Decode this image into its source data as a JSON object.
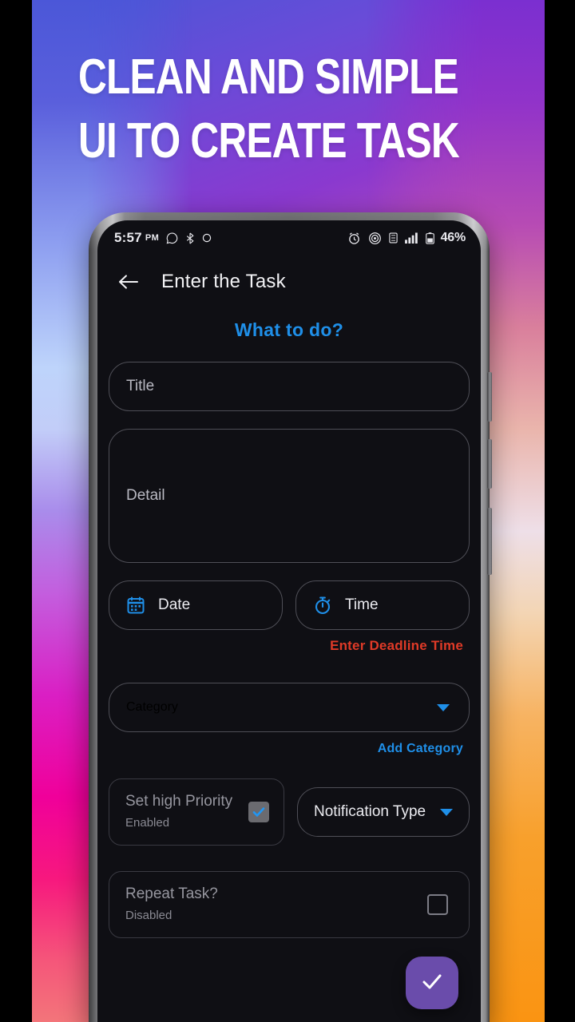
{
  "promo": {
    "headline_line1": "CLEAN AND SIMPLE",
    "headline_line2": "UI TO CREATE TASK",
    "accent_blue": "#1f8fe8",
    "accent_purple": "#6a4cab",
    "error_red": "#e03a27"
  },
  "statusbar": {
    "time": "5:57",
    "ampm": "PM",
    "left_icons": [
      "whatsapp-icon",
      "bluetooth-share-icon",
      "circle-icon"
    ],
    "right_icons": [
      "alarm-icon",
      "hotspot-icon",
      "sim-icon",
      "signal-icon",
      "battery-icon"
    ],
    "battery_percent": "46%"
  },
  "appbar": {
    "back_label": "back-arrow",
    "title": "Enter the Task"
  },
  "form": {
    "section_heading": "What to do?",
    "title_placeholder": "Title",
    "detail_placeholder": "Detail",
    "date_label": "Date",
    "time_label": "Time",
    "deadline_error": "Enter Deadline Time",
    "category_placeholder": "Category",
    "add_category_link": "Add Category",
    "priority": {
      "title": "Set high Priority",
      "state": "Enabled",
      "checked": true
    },
    "notification_type_label": "Notification Type",
    "repeat": {
      "title": "Repeat Task?",
      "state": "Disabled",
      "checked": false
    },
    "submit_label": "check-icon"
  }
}
